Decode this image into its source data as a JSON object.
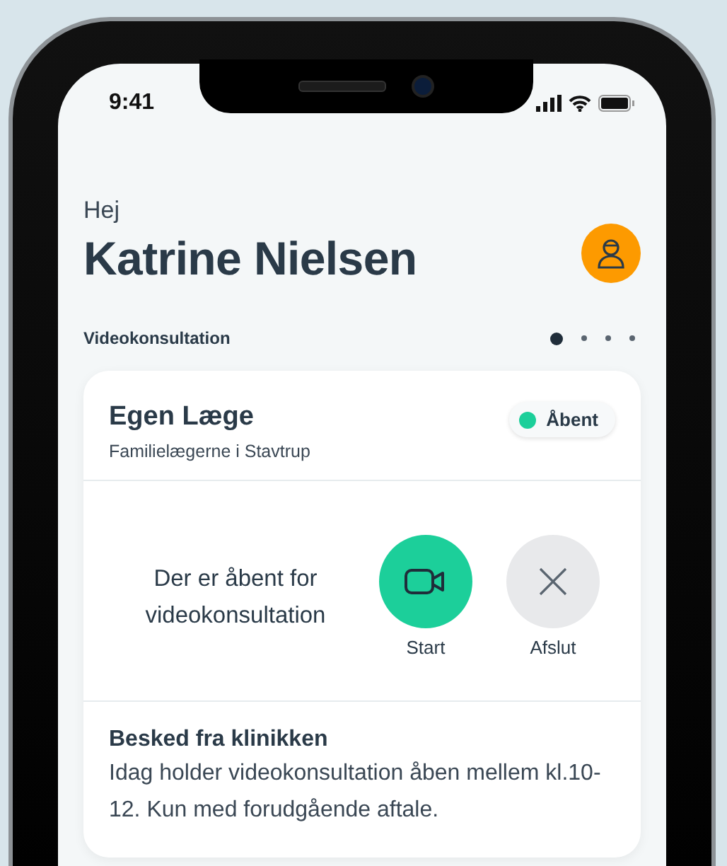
{
  "status_bar": {
    "time": "9:41"
  },
  "greeting": {
    "hello": "Hej",
    "name": "Katrine Nielsen"
  },
  "section": {
    "title": "Videokonsultation",
    "pager": [
      {
        "selected": true
      },
      {
        "selected": false
      },
      {
        "selected": false
      },
      {
        "selected": false
      }
    ]
  },
  "card": {
    "title": "Egen Læge",
    "subtitle": "Familielægerne i Stavtrup",
    "status": {
      "label": "Åbent",
      "color": "#1ccf9a"
    },
    "info": "Der er åbent for videokonsultation",
    "actions": [
      {
        "kind": "start",
        "label": "Start"
      },
      {
        "kind": "end",
        "label": "Afslut"
      }
    ],
    "message": {
      "title": "Besked fra klinikken",
      "text": "Idag holder videokonsultation åben mellem kl.10-12. Kun med forudgående aftale."
    }
  }
}
